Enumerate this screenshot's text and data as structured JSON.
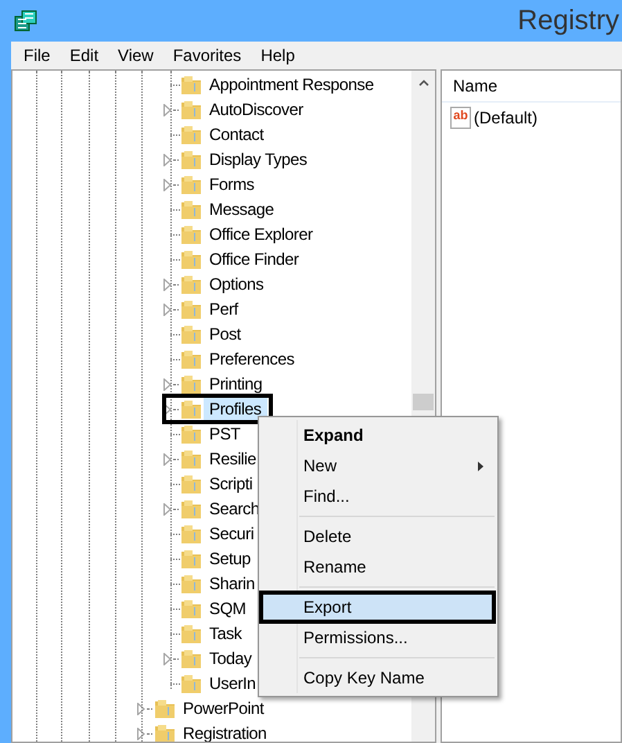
{
  "window": {
    "title": "Registry"
  },
  "menu_bar": [
    "File",
    "Edit",
    "View",
    "Favorites",
    "Help"
  ],
  "tree": [
    {
      "children": [
        {
          "label": "Appointment Response",
          "expandable": false,
          "selected": false
        },
        {
          "label": "AutoDiscover",
          "expandable": true,
          "selected": false
        },
        {
          "label": "Contact",
          "expandable": false,
          "selected": false
        },
        {
          "label": "Display Types",
          "expandable": true,
          "selected": false
        },
        {
          "label": "Forms",
          "expandable": true,
          "selected": false
        },
        {
          "label": "Message",
          "expandable": false,
          "selected": false
        },
        {
          "label": "Office Explorer",
          "expandable": false,
          "selected": false
        },
        {
          "label": "Office Finder",
          "expandable": false,
          "selected": false
        },
        {
          "label": "Options",
          "expandable": true,
          "selected": false
        },
        {
          "label": "Perf",
          "expandable": true,
          "selected": false
        },
        {
          "label": "Post",
          "expandable": false,
          "selected": false
        },
        {
          "label": "Preferences",
          "expandable": false,
          "selected": false
        },
        {
          "label": "Printing",
          "expandable": true,
          "selected": false
        },
        {
          "label": "Profiles",
          "expandable": true,
          "selected": true,
          "annotated": true
        },
        {
          "label": "PST",
          "expandable": false,
          "selected": false
        },
        {
          "label": "Resilie",
          "expandable": true,
          "selected": false
        },
        {
          "label": "Scripti",
          "expandable": false,
          "selected": false
        },
        {
          "label": "Search",
          "expandable": true,
          "selected": false
        },
        {
          "label": "Securi",
          "expandable": false,
          "selected": false
        },
        {
          "label": "Setup",
          "expandable": false,
          "selected": false
        },
        {
          "label": "Sharin",
          "expandable": false,
          "selected": false
        },
        {
          "label": "SQM",
          "expandable": false,
          "selected": false
        },
        {
          "label": "Task",
          "expandable": false,
          "selected": false
        },
        {
          "label": "Today",
          "expandable": true,
          "selected": false
        },
        {
          "label": "UserIn",
          "expandable": false,
          "selected": false
        }
      ]
    },
    {
      "label": "PowerPoint",
      "expandable": true,
      "selected": false
    },
    {
      "label": "Registration",
      "expandable": true,
      "selected": false
    }
  ],
  "values_pane": {
    "column": "Name",
    "rows": [
      {
        "icon_label": "ab",
        "name": "(Default)"
      }
    ]
  },
  "context_menu": [
    {
      "kind": "item",
      "label": "Expand",
      "bold": true,
      "submenu": false,
      "selected": false
    },
    {
      "kind": "item",
      "label": "New",
      "bold": false,
      "submenu": true,
      "selected": false
    },
    {
      "kind": "item",
      "label": "Find...",
      "bold": false,
      "submenu": false,
      "selected": false
    },
    {
      "kind": "separator"
    },
    {
      "kind": "item",
      "label": "Delete",
      "bold": false,
      "submenu": false,
      "selected": false
    },
    {
      "kind": "item",
      "label": "Rename",
      "bold": false,
      "submenu": false,
      "selected": false
    },
    {
      "kind": "separator"
    },
    {
      "kind": "item",
      "label": "Export",
      "bold": false,
      "submenu": false,
      "selected": true,
      "annotated": true
    },
    {
      "kind": "item",
      "label": "Permissions...",
      "bold": false,
      "submenu": false,
      "selected": false
    },
    {
      "kind": "separator"
    },
    {
      "kind": "item",
      "label": "Copy Key Name",
      "bold": false,
      "submenu": false,
      "selected": false
    }
  ]
}
